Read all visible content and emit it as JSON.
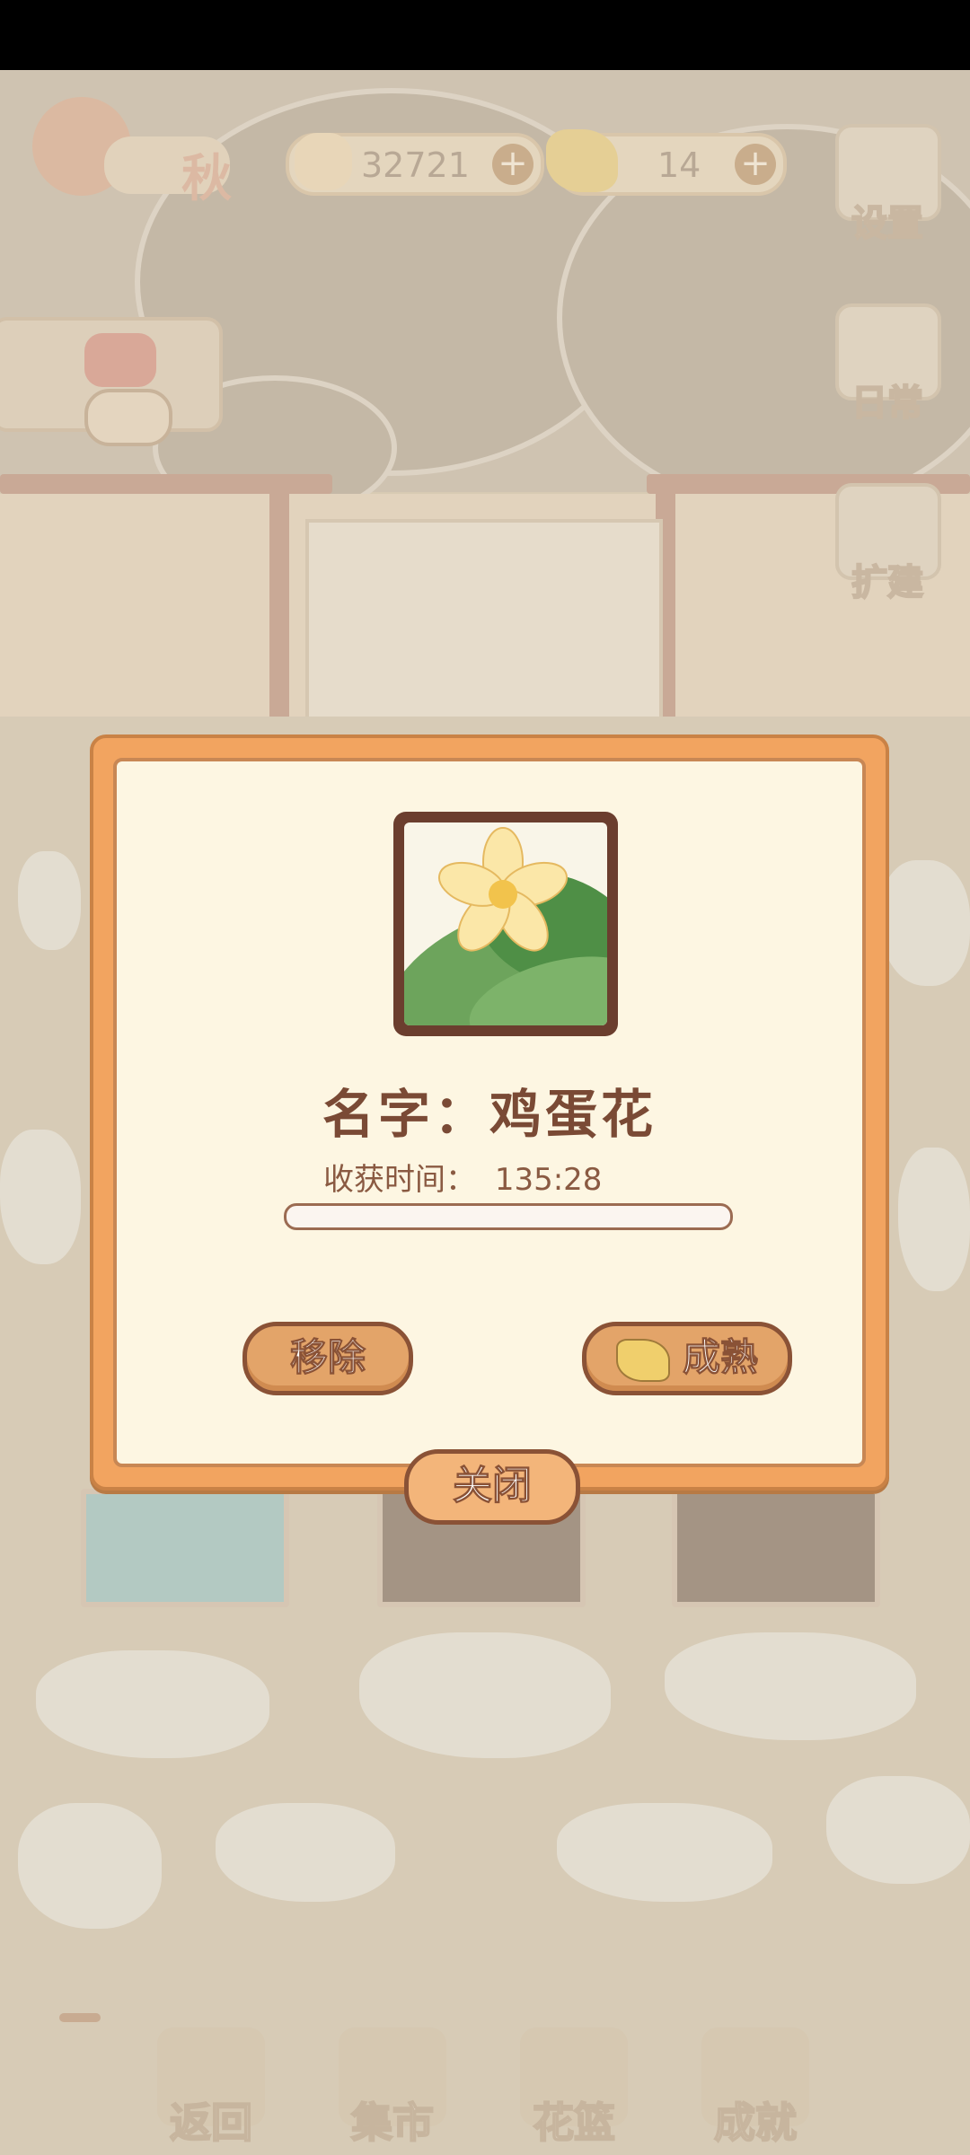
{
  "hud": {
    "season_label": "秋",
    "fish_count": "32721",
    "cheese_count": "14",
    "plus_symbol": "+"
  },
  "side_menu": {
    "settings": "设置",
    "daily": "日常",
    "expand": "扩建"
  },
  "bottom_nav": {
    "back": "返回",
    "market": "集市",
    "basket": "花篮",
    "achievement": "成就"
  },
  "dialog": {
    "name_label": "名字：鸡蛋花",
    "harvest_label": "收获时间：",
    "harvest_time": "135:28",
    "progress_fraction": 0.0,
    "remove_label": "移除",
    "ripen_label": "成熟",
    "close_label": "关闭"
  },
  "colors": {
    "dialog_frame": "#f2a460",
    "dialog_bg": "#fdf6e2",
    "text_brown": "#7a4a35",
    "button_fill": "#e3a469"
  },
  "icons": [
    "season-tree-icon",
    "fish-bone-icon",
    "cheese-icon",
    "gear-icon",
    "notepad-icon",
    "paint-bucket-icon",
    "watering-can-icon",
    "play-icon",
    "flower-icon",
    "cheese-button-icon"
  ]
}
